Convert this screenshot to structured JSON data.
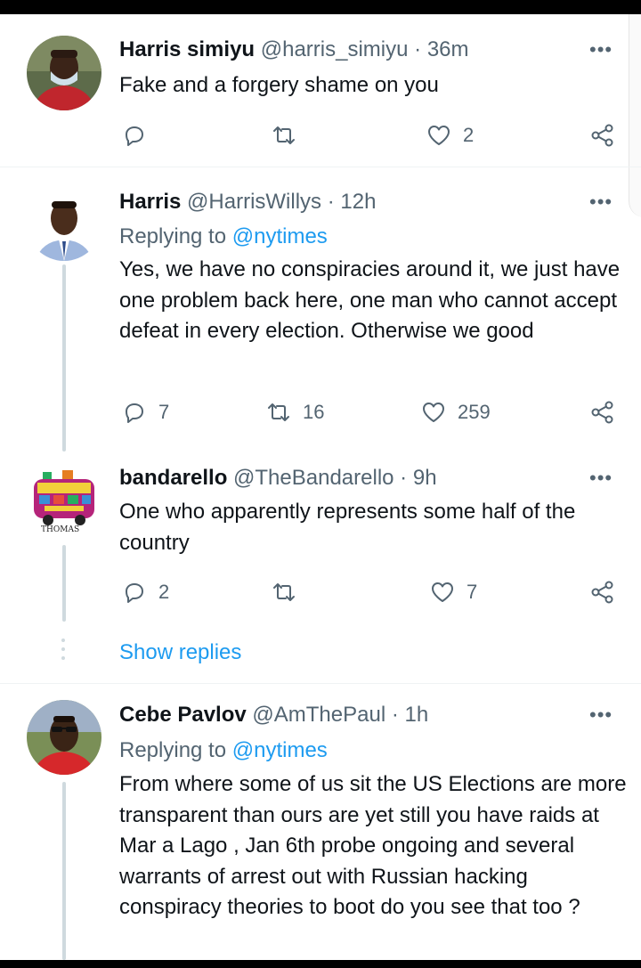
{
  "tweets": [
    {
      "name": "Harris simiyu",
      "handle": "@harris_simiyu",
      "sep": "·",
      "time": "36m",
      "replying_label": "",
      "replying_to": "",
      "text": "Fake and a forgery shame on you",
      "actions": {
        "replies": "",
        "retweets": "",
        "likes": "2"
      },
      "avatar": "avatar-masked-man"
    },
    {
      "name": "Harris",
      "handle": "@HarrisWillys",
      "sep": "·",
      "time": "12h",
      "replying_label": "Replying to",
      "replying_to": "@nytimes",
      "text": "Yes, we have no conspiracies around it, we just have one problem back here, one man who cannot accept defeat in every election. Otherwise we good",
      "actions": {
        "replies": "7",
        "retweets": "16",
        "likes": "259"
      },
      "avatar": "avatar-man-tie"
    },
    {
      "name": "bandarello",
      "handle": "@TheBandarello",
      "sep": "·",
      "time": "9h",
      "replying_label": "",
      "replying_to": "",
      "text": "One who apparently represents some half of the country",
      "actions": {
        "replies": "2",
        "retweets": "",
        "likes": "7"
      },
      "avatar": "avatar-bus-cartoon",
      "avatar_caption": "THOMAS"
    },
    {
      "name": "Cebe Pavlov",
      "handle": "@AmThePaul",
      "sep": "·",
      "time": "1h",
      "replying_label": "Replying to",
      "replying_to": "@nytimes",
      "text": "From where some of us sit the US Elections are more transparent than ours are yet still you have raids at Mar a Lago , Jan 6th probe ongoing and several warrants of arrest out with Russian hacking conspiracy theories to boot  do you see that too ?",
      "actions": {
        "replies": "",
        "retweets": "",
        "likes": ""
      },
      "avatar": "avatar-man-sunglasses"
    }
  ],
  "show_replies": "Show replies",
  "more_glyph": "•••",
  "colors": {
    "link": "#1d9bf0",
    "muted": "#536471",
    "text": "#0f1419"
  },
  "icons": [
    "reply-icon",
    "retweet-icon",
    "like-icon",
    "share-icon",
    "more-icon"
  ]
}
